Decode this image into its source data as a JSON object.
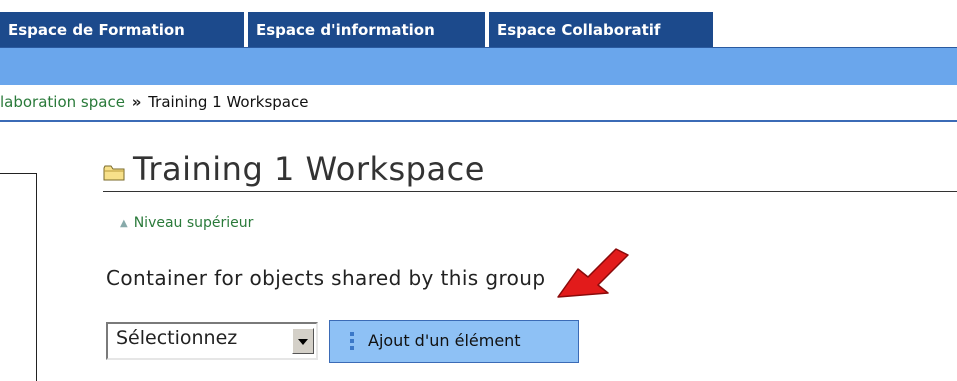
{
  "tabs": [
    {
      "label": "Espace de Formation"
    },
    {
      "label": "Espace d'information"
    },
    {
      "label": "Espace Collaboratif"
    }
  ],
  "breadcrumb": {
    "parent": "laboration space",
    "separator": "»",
    "current": "Training 1 Workspace"
  },
  "page": {
    "title": "Training 1 Workspace",
    "up_link": "Niveau supérieur",
    "description": "Container for objects shared by this group"
  },
  "actions": {
    "select_value": "Sélectionnez",
    "add_label": "Ajout d'un élément"
  },
  "colors": {
    "tab_bg": "#1c4a8c",
    "bar_bg": "#6aa6ec",
    "button_bg": "#8ec1f5",
    "link": "#2a7a3a",
    "pointer": "#e21b1b"
  },
  "icons": {
    "folder": "folder-icon",
    "up_arrow": "up-arrow-icon",
    "dropdown": "chevron-down-icon",
    "pointer": "red-arrow-pointer"
  }
}
